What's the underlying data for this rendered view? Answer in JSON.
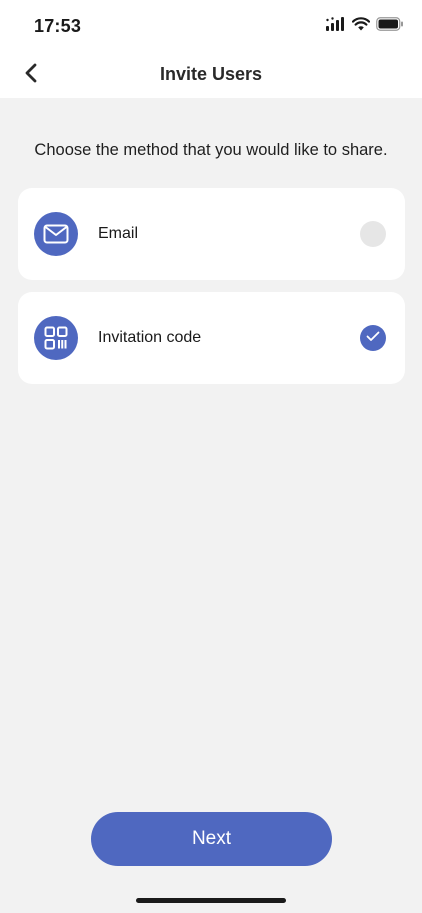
{
  "status_bar": {
    "time": "17:53",
    "icons": [
      "signal-icon",
      "wifi-icon",
      "battery-icon"
    ]
  },
  "header": {
    "title": "Invite Users",
    "back_icon": "chevron-left-icon"
  },
  "main": {
    "instruction": "Choose the method that you would like to share.",
    "options": [
      {
        "label": "Email",
        "icon": "mail-icon",
        "selected": false
      },
      {
        "label": "Invitation code",
        "icon": "qr-code-icon",
        "selected": true
      }
    ]
  },
  "footer": {
    "next_label": "Next"
  },
  "colors": {
    "accent": "#4f68c0",
    "background": "#f2f2f2",
    "card": "#ffffff",
    "radio_unselected": "#e6e6e6"
  }
}
